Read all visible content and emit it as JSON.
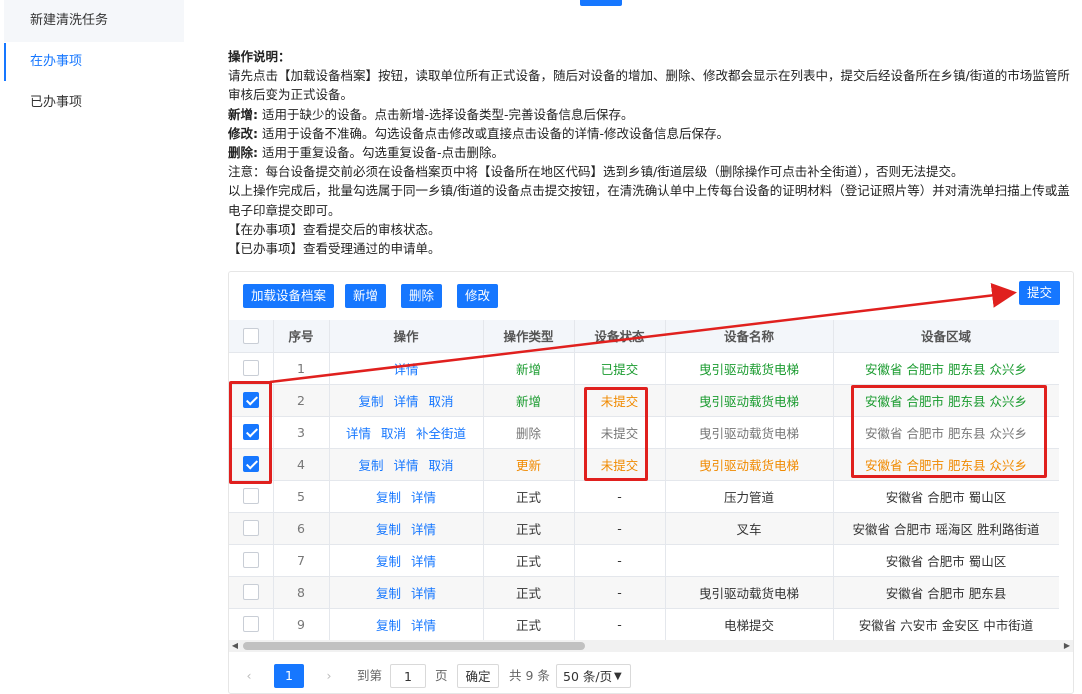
{
  "sidebar": {
    "items": [
      {
        "label": "新建清洗任务"
      },
      {
        "label": "在办事项"
      },
      {
        "label": "已办事项"
      }
    ]
  },
  "instructions": {
    "title": "操作说明：",
    "line1": "请先点击【加载设备档案】按钮，读取单位所有正式设备，随后对设备的增加、删除、修改都会显示在列表中，提交后经设备所在乡镇/街道的市场监管所",
    "line1b": "审核后变为正式设备。",
    "add_label": "新增:",
    "add_text": " 适用于缺少的设备。点击新增-选择设备类型-完善设备信息后保存。",
    "edit_label": "修改:",
    "edit_text": " 适用于设备不准确。勾选设备点击修改或直接点击设备的详情-修改设备信息后保存。",
    "del_label": "删除:",
    "del_text": " 适用于重复设备。勾选重复设备-点击删除。",
    "note": "注意：每台设备提交前必须在设备档案页中将【设备所在地区代码】选到乡镇/街道层级（删除操作可点击补全街道），否则无法提交。",
    "after1": "以上操作完成后，批量勾选属于同一乡镇/街道的设备点击提交按钮，在清洗确认单中上传每台设备的证明材料（登记证照片等）并对清洗单扫描上传或盖",
    "after1b": "电子印章提交即可。",
    "inprogress": "【在办事项】查看提交后的审核状态。",
    "done": "【已办事项】查看受理通过的申请单。"
  },
  "toolbar": {
    "load_label": "加载设备档案",
    "add_label": "新增",
    "delete_label": "删除",
    "edit_label": "修改",
    "submit_label": "提交"
  },
  "table": {
    "headers": [
      "序号",
      "操作",
      "操作类型",
      "设备状态",
      "设备名称",
      "设备区域"
    ],
    "rows": [
      {
        "checked": false,
        "no": "1",
        "actions": [
          "详情"
        ],
        "type": "新增",
        "status": "已提交",
        "name": "曳引驱动载货电梯",
        "area": "安徽省 合肥市 肥东县 众兴乡",
        "color": "green",
        "type_color": "green",
        "status_color": "green"
      },
      {
        "checked": true,
        "no": "2",
        "actions": [
          "复制",
          "详情",
          "取消"
        ],
        "type": "新增",
        "status": "未提交",
        "name": "曳引驱动载货电梯",
        "area": "安徽省 合肥市 肥东县 众兴乡",
        "color": "green",
        "type_color": "green",
        "status_color": "orange"
      },
      {
        "checked": true,
        "no": "3",
        "actions": [
          "详情",
          "取消",
          "补全街道"
        ],
        "type": "删除",
        "status": "未提交",
        "name": "曳引驱动载货电梯",
        "area": "安徽省 合肥市 肥东县 众兴乡",
        "color": "gray",
        "type_color": "gray",
        "status_color": "gray"
      },
      {
        "checked": true,
        "no": "4",
        "actions": [
          "复制",
          "详情",
          "取消"
        ],
        "type": "更新",
        "status": "未提交",
        "name": "曳引驱动载货电梯",
        "area": "安徽省 合肥市 肥东县 众兴乡",
        "color": "orange",
        "type_color": "orange",
        "status_color": "orange"
      },
      {
        "checked": false,
        "no": "5",
        "actions": [
          "复制",
          "详情"
        ],
        "type": "正式",
        "status": "-",
        "name": "压力管道",
        "area": "安徽省 合肥市 蜀山区",
        "color": "",
        "type_color": "",
        "status_color": ""
      },
      {
        "checked": false,
        "no": "6",
        "actions": [
          "复制",
          "详情"
        ],
        "type": "正式",
        "status": "-",
        "name": "叉车",
        "area": "安徽省 合肥市 瑶海区 胜利路街道",
        "color": "",
        "type_color": "",
        "status_color": ""
      },
      {
        "checked": false,
        "no": "7",
        "actions": [
          "复制",
          "详情"
        ],
        "type": "正式",
        "status": "-",
        "name": "",
        "area": "安徽省 合肥市 蜀山区",
        "color": "",
        "type_color": "",
        "status_color": ""
      },
      {
        "checked": false,
        "no": "8",
        "actions": [
          "复制",
          "详情"
        ],
        "type": "正式",
        "status": "-",
        "name": "曳引驱动载货电梯",
        "area": "安徽省 合肥市 肥东县",
        "color": "",
        "type_color": "",
        "status_color": ""
      },
      {
        "checked": false,
        "no": "9",
        "actions": [
          "复制",
          "详情"
        ],
        "type": "正式",
        "status": "-",
        "name": "电梯提交",
        "area": "安徽省 六安市 金安区 中市街道",
        "color": "",
        "type_color": "",
        "status_color": ""
      }
    ]
  },
  "pager": {
    "current": "1",
    "goto_label": "到第",
    "goto_value": "1",
    "page_unit": "页",
    "confirm": "确定",
    "total": "共 9 条",
    "page_size": "50 条/页"
  },
  "icons": {
    "prev": "chevron-left-icon",
    "next": "chevron-right-icon",
    "select": "chevron-down-icon"
  },
  "colors": {
    "accent": "#1677ff",
    "green": "#1a9b2f",
    "orange": "#f08a00",
    "annotation": "#e0201e"
  }
}
